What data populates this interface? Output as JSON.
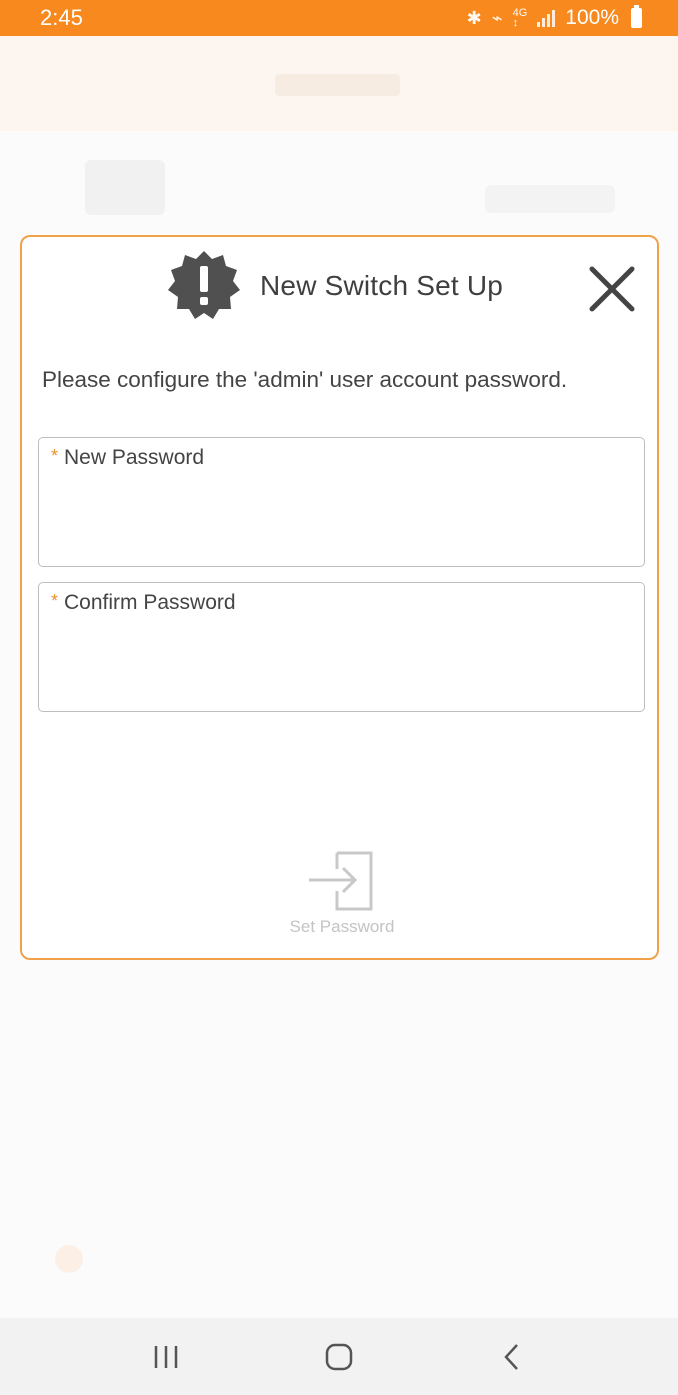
{
  "status_bar": {
    "time": "2:45",
    "battery": "100%",
    "icons": [
      "bluetooth-icon",
      "mute-icon",
      "4g-icon",
      "signal-icon",
      "battery-icon"
    ],
    "background_color": "#f7891e"
  },
  "modal": {
    "title": "New Switch Set Up",
    "header_icon": "alert-icon",
    "close_icon": "close-icon",
    "instruction": "Please configure the 'admin' user account password.",
    "border_color": "#f0a24a",
    "fields": {
      "new_password": {
        "label": "New Password",
        "required_mark": "*",
        "value": ""
      },
      "confirm_password": {
        "label": "Confirm Password",
        "required_mark": "*",
        "value": ""
      }
    },
    "action": {
      "label": "Set Password",
      "icon": "login-arrow-icon",
      "enabled": false
    }
  },
  "nav_bar": {
    "items": [
      "recent-apps-icon",
      "home-icon",
      "back-icon"
    ]
  }
}
